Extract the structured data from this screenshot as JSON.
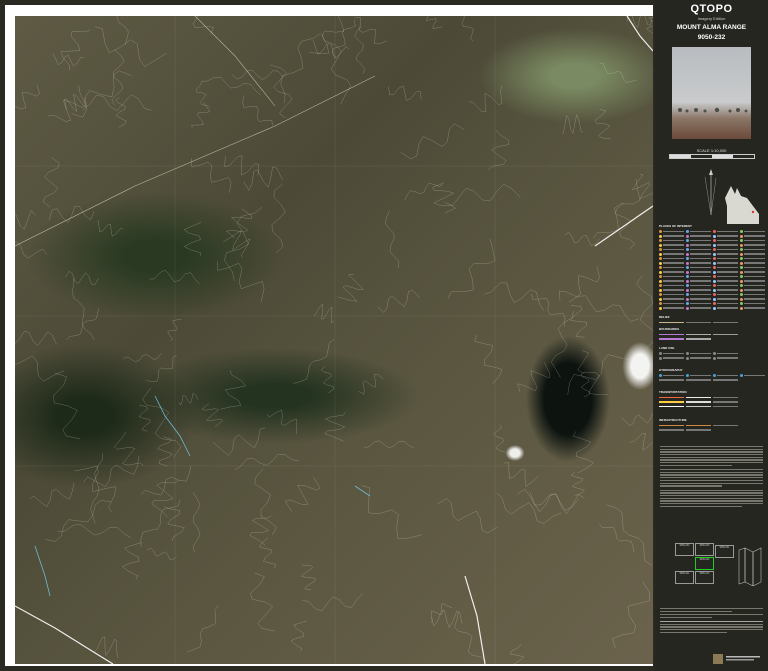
{
  "brand": "QTOPO",
  "edition": "Imagery Edition",
  "sheet": {
    "name": "MOUNT ALMA RANGE",
    "number": "9050-232"
  },
  "scale": {
    "label": "SCALE 1:10,000"
  },
  "map": {
    "description_icon": "satellite-imagery-topographic-map",
    "colors": {
      "frame": "#ffffff",
      "panel": "#262621",
      "contour": "#e6e4d6",
      "water": "#6ec8e6",
      "road": "#ffffff"
    }
  },
  "legend": {
    "headings": [
      "PLACES OF INTEREST",
      "RELIEF",
      "BOUNDARIES",
      "LAND USE",
      "HYDROGRAPHY",
      "TRANSPORTATION",
      "INFRASTRUCTURE"
    ]
  },
  "index_diagram": {
    "cells": [
      {
        "number": "9050-234"
      },
      {
        "number": "9050-233"
      },
      {
        "number": "9050-231"
      },
      {
        "number": "9050-232"
      },
      {
        "number": "9050-221"
      },
      {
        "number": "9050-214"
      }
    ]
  }
}
